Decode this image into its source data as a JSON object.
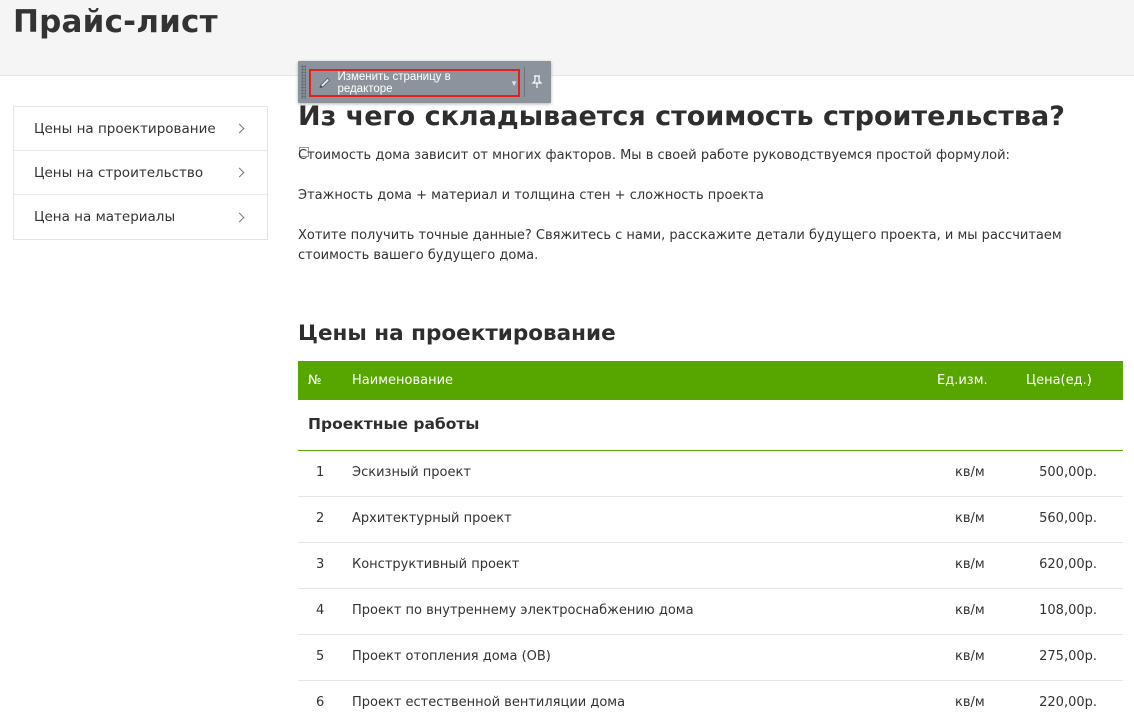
{
  "page": {
    "title": "Прайс-лист"
  },
  "sidebar": {
    "items": [
      {
        "label": "Цены на проектирование"
      },
      {
        "label": "Цены на строительство"
      },
      {
        "label": "Цена на материалы"
      }
    ]
  },
  "editor_toolbar": {
    "edit_label": "Изменить страницу в редакторе"
  },
  "content": {
    "heading": "Из чего складывается стоимость строительства?",
    "paragraphs": [
      "Стоимость дома зависит от многих факторов. Мы в своей работе руководствуемся простой формулой:",
      "Этажность дома + материал и толщина стен + сложность проекта",
      "Хотите получить точные данные? Свяжитесь с нами, расскажите детали будущего проекта, и мы рассчитаем стоимость вашего будущего дома."
    ],
    "section_title": "Цены на проектирование"
  },
  "table": {
    "headers": {
      "num": "№",
      "name": "Наименование",
      "unit": "Ед.изм.",
      "price": "Цена(ед.)"
    },
    "group": "Проектные работы",
    "rows": [
      {
        "num": "1",
        "name": "Эскизный проект",
        "unit": "кв/м",
        "price": "500,00р."
      },
      {
        "num": "2",
        "name": "Архитектурный проект",
        "unit": "кв/м",
        "price": "560,00р."
      },
      {
        "num": "3",
        "name": "Конструктивный проект",
        "unit": "кв/м",
        "price": "620,00р."
      },
      {
        "num": "4",
        "name": "Проект по внутреннему электроснабжению дома",
        "unit": "кв/м",
        "price": "108,00р."
      },
      {
        "num": "5",
        "name": "Проект отопления дома (ОВ)",
        "unit": "кв/м",
        "price": "275,00р."
      },
      {
        "num": "6",
        "name": "Проект естественной вентиляции дома",
        "unit": "кв/м",
        "price": "220,00р."
      }
    ]
  },
  "colors": {
    "accent": "#57a600",
    "toolbar": "#8c939c",
    "highlight": "#e0211e"
  }
}
